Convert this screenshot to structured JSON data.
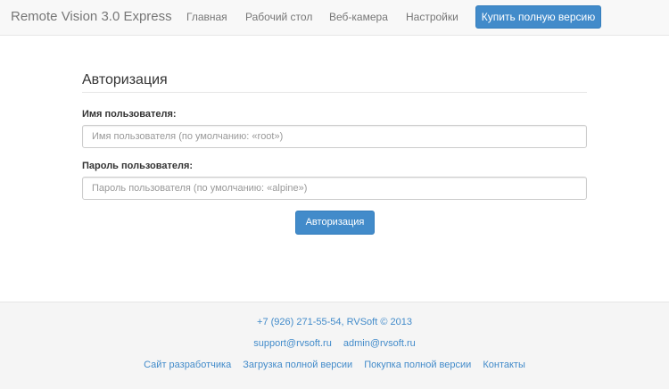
{
  "navbar": {
    "brand": "Remote Vision 3.0 Express",
    "links": [
      "Главная",
      "Рабочий стол",
      "Веб-камера",
      "Настройки"
    ],
    "buy_button": "Купить полную версию"
  },
  "form": {
    "title": "Авторизация",
    "username_label": "Имя пользователя:",
    "username_placeholder": "Имя пользователя (по умолчанию: «root»)",
    "password_label": "Пароль пользователя:",
    "password_placeholder": "Пароль пользователя (по умолчанию: «alpine»)",
    "submit_label": "Авторизация"
  },
  "footer": {
    "contact": "+7 (926) 271-55-54, RVSoft © 2013",
    "emails": [
      "support@rvsoft.ru",
      "admin@rvsoft.ru"
    ],
    "links": [
      "Сайт разработчика",
      "Загрузка полной версии",
      "Покупка полной версии",
      "Контакты"
    ]
  },
  "colors": {
    "accent": "#428bca",
    "navbar_bg": "#f8f8f8",
    "footer_bg": "#f5f5f5"
  }
}
